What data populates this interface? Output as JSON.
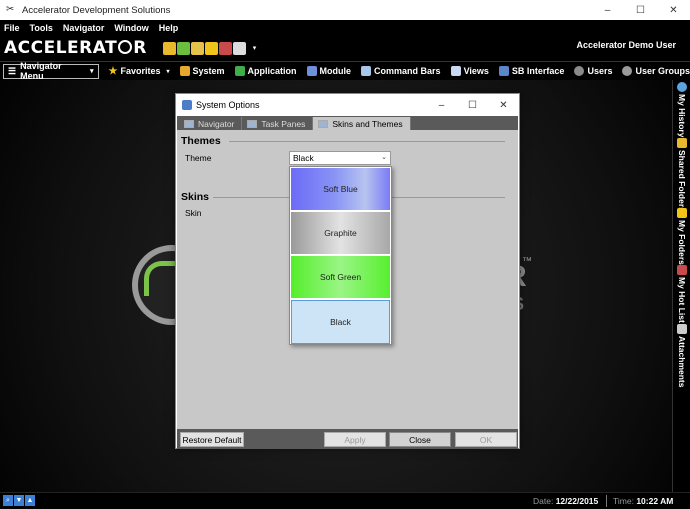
{
  "window": {
    "title": "Accelerator Development Solutions",
    "controls": [
      "–",
      "☐",
      "✕"
    ]
  },
  "menubar": [
    "File",
    "Tools",
    "Navigator",
    "Window",
    "Help"
  ],
  "header": {
    "logo_part1": "ACCELERAT",
    "logo_part2": "R",
    "user": "Accelerator Demo User"
  },
  "toolbar": {
    "nav_menu": "Navigator Menu",
    "items": [
      "Favorites",
      "System",
      "Application",
      "Module",
      "Command Bars",
      "Views",
      "SB Interface",
      "Users",
      "User Groups"
    ]
  },
  "sidedock": [
    "My History",
    "Shared Folders",
    "My Folders",
    "My Hot List",
    "Attachments"
  ],
  "background": {
    "text_r": "R",
    "text_tm": "™",
    "text_s": "S"
  },
  "statusbar": {
    "date_label": "Date:",
    "date": "12/22/2015",
    "time_label": "Time:",
    "time": "10:22 AM"
  },
  "dialog": {
    "title": "System Options",
    "tabs": [
      "Navigator",
      "Task Panes",
      "Skins and Themes"
    ],
    "themes_heading": "Themes",
    "theme_label": "Theme",
    "theme_value": "Black",
    "theme_options": [
      "Soft Blue",
      "Graphite",
      "Soft Green",
      "Black"
    ],
    "skins_heading": "Skins",
    "skin_label": "Skin",
    "buttons": {
      "restore": "Restore Default",
      "apply": "Apply",
      "close": "Close",
      "ok": "OK"
    }
  },
  "colors": {
    "accent_blue": "#3c7fd6",
    "selected_option": "#cde4f7"
  }
}
